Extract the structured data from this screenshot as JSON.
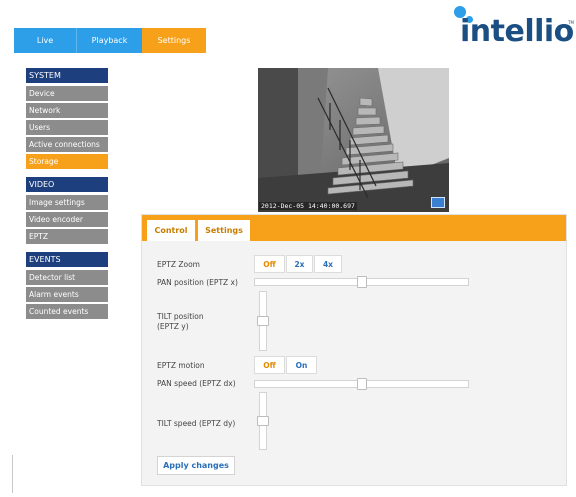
{
  "topnav": {
    "tabs": [
      {
        "label": "Live"
      },
      {
        "label": "Playback"
      },
      {
        "label": "Settings"
      }
    ],
    "active": "Settings"
  },
  "logo": {
    "text": "intellio",
    "tm": "TM"
  },
  "sidebar": {
    "system": {
      "header": "SYSTEM",
      "items": [
        "Device",
        "Network",
        "Users",
        "Active connections",
        "Storage"
      ]
    },
    "video": {
      "header": "VIDEO",
      "items": [
        "Image settings",
        "Video encoder",
        "EPTZ"
      ]
    },
    "events": {
      "header": "EVENTS",
      "items": [
        "Detector list",
        "Alarm events",
        "Counted events"
      ]
    },
    "active_item": "Storage"
  },
  "camera": {
    "timestamp": "2012-Dec-05 14:40:00.697",
    "overlay_icon": "monitor-icon"
  },
  "panel": {
    "tabs": {
      "control": "Control",
      "settings": "Settings"
    },
    "active_tab": "Control",
    "eptz_zoom": {
      "label": "EPTZ Zoom",
      "options": [
        "Off",
        "2x",
        "4x"
      ],
      "selected": "Off"
    },
    "pan_position": {
      "label": "PAN  position (EPTZ x)",
      "value_fraction": 0.5
    },
    "tilt_position": {
      "label_line1": "TILT position",
      "label_line2": "(EPTZ y)",
      "value_fraction": 0.5
    },
    "eptz_motion": {
      "label": "EPTZ motion",
      "options": [
        "Off",
        "On"
      ],
      "selected": "Off"
    },
    "pan_speed": {
      "label": "PAN speed (EPTZ dx)",
      "value_fraction": 0.5
    },
    "tilt_speed": {
      "label": "TILT speed (EPTZ dy)",
      "value_fraction": 0.5
    },
    "apply_label": "Apply changes"
  },
  "colors": {
    "accent_orange": "#f7a11a",
    "nav_blue": "#2d9ee8",
    "sidebar_header": "#1e3f7e",
    "sidebar_item": "#8c8c8c",
    "logo_blue": "#1b4f83"
  }
}
